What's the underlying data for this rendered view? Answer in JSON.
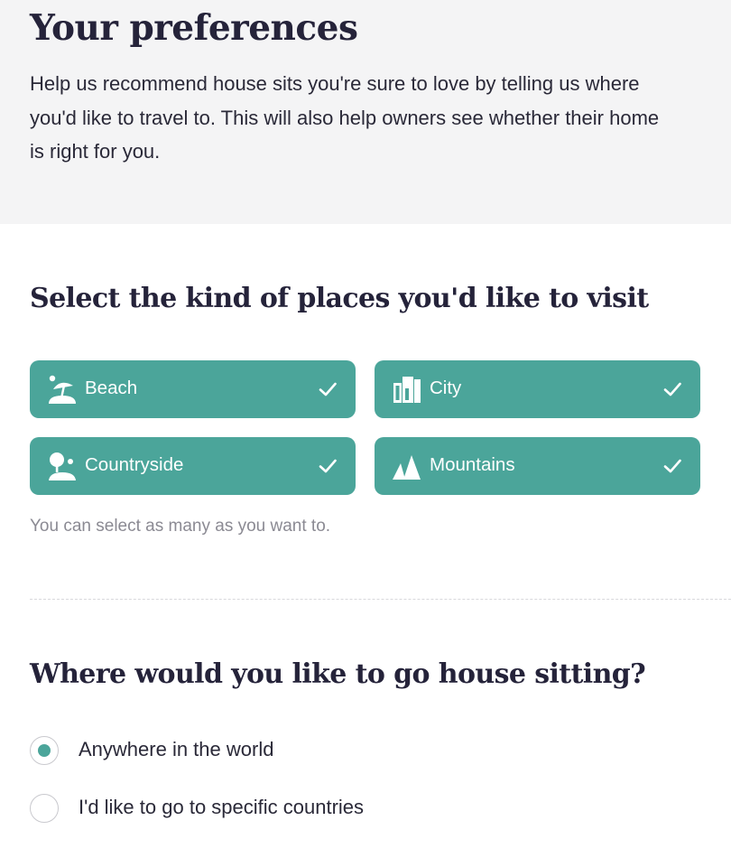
{
  "header": {
    "title": "Your preferences",
    "intro": "Help us recommend house sits you're sure to love by telling us where you'd like to travel to. This will also help owners see whether their home is right for you."
  },
  "places": {
    "title": "Select the kind of places you'd like to visit",
    "options": [
      {
        "label": "Beach",
        "icon": "beach-umbrella-icon",
        "selected": true
      },
      {
        "label": "City",
        "icon": "city-buildings-icon",
        "selected": true
      },
      {
        "label": "Countryside",
        "icon": "tree-countryside-icon",
        "selected": true
      },
      {
        "label": "Mountains",
        "icon": "mountains-icon",
        "selected": true
      }
    ],
    "hint": "You can select as many as you want to."
  },
  "location": {
    "title": "Where would you like to go house sitting?",
    "options": [
      {
        "label": "Anywhere in the world",
        "selected": true
      },
      {
        "label": "I'd like to go to specific countries",
        "selected": false
      }
    ]
  },
  "colors": {
    "accent": "#4ba59a",
    "header_bg": "#f4f4f5",
    "text": "#25233a",
    "muted": "#8b8a93"
  }
}
